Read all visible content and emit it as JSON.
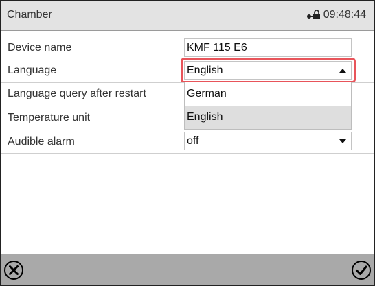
{
  "header": {
    "title": "Chamber",
    "time": "09:48:44",
    "lock_icon": "lock-key-icon"
  },
  "settings": [
    {
      "label": "Device name",
      "value": "KMF 115 E6"
    },
    {
      "label": "Language",
      "value": "English"
    },
    {
      "label": "Language query after restart"
    },
    {
      "label": "Temperature unit"
    },
    {
      "label": "Audible alarm",
      "value": "off"
    }
  ],
  "language_dropdown": {
    "open": true,
    "options": [
      "German",
      "English"
    ],
    "selected": "English"
  },
  "footer": {
    "cancel_icon": "cancel-circle-icon",
    "confirm_icon": "confirm-check-circle-icon"
  },
  "colors": {
    "header_bg": "#e3e3e3",
    "footer_bg": "#a9a9a9",
    "highlight": "#e8545a",
    "selected_option_bg": "#dedede"
  }
}
